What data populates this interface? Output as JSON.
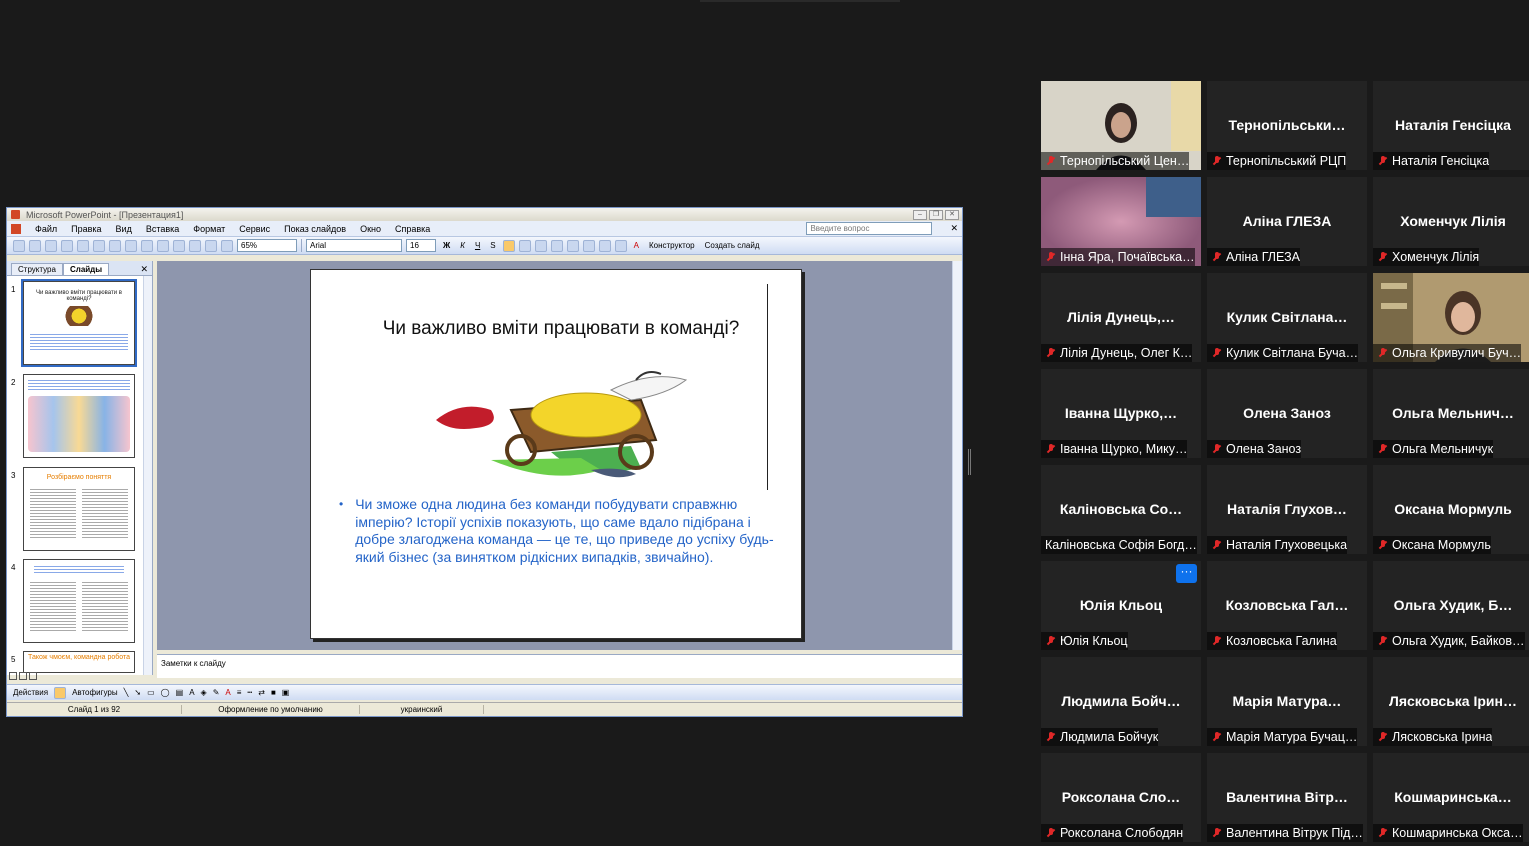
{
  "ppt": {
    "window_title": "Microsoft PowerPoint - [Презентация1]",
    "menu": [
      "Файл",
      "Правка",
      "Вид",
      "Вставка",
      "Формат",
      "Сервис",
      "Показ слайдов",
      "Окно",
      "Справка"
    ],
    "ask_placeholder": "Введите вопрос",
    "zoom": "65%",
    "font": "Arial",
    "font_size": "16",
    "designer_label": "Конструктор",
    "new_slide_label": "Создать слайд",
    "tabs": [
      "Структура",
      "Слайды"
    ],
    "thumbs": [
      {
        "num": "1"
      },
      {
        "num": "2"
      },
      {
        "num": "3",
        "title": "Розбіраємо поняття"
      },
      {
        "num": "4"
      },
      {
        "num": "5",
        "title": "Також чмоєм, командна робота"
      }
    ],
    "slide": {
      "title": "Чи важливо вміти працювати в команді?",
      "bullet": "Чи зможе одна людина без команди побудувати справжню імперію? Історії успіхів показують, що саме вдало підібрана і добре злагоджена команда — це те, що приведе до успіху будь-який бізнес (за винятком рідкісних випадків, звичайно)."
    },
    "notes_placeholder": "Заметки к слайду",
    "draw_actions": "Действия",
    "draw_autoshapes": "Автофигуры",
    "status": {
      "slide": "Слайд 1 из 92",
      "design": "Оформление по умолчанию",
      "lang": "украинский"
    }
  },
  "participants": [
    {
      "name": "",
      "label": "Тернопільський Цен…",
      "video": "woman-dark"
    },
    {
      "name": "Тернопільськи…",
      "label": "Тернопільський РЦП"
    },
    {
      "name": "Наталія Генсіцка",
      "label": "Наталія Генсіцка"
    },
    {
      "name": "",
      "label": "Інна Яра, Почаївська…",
      "video": "blur-pink"
    },
    {
      "name": "Аліна ГЛЕЗА",
      "label": "Аліна ГЛЕЗА"
    },
    {
      "name": "Хоменчук Лілія",
      "label": "Хоменчук Лілія"
    },
    {
      "name": "Лілія Дунець,…",
      "label": "Лілія Дунець, Олег К…"
    },
    {
      "name": "Кулик Світлана…",
      "label": "Кулик Світлана Буча…"
    },
    {
      "name": "",
      "label": "Ольга Кривулич Буч…",
      "video": "woman-shelf"
    },
    {
      "name": "Іванна Щурко,…",
      "label": "Іванна Щурко, Мику…"
    },
    {
      "name": "Олена Заноз",
      "label": "Олена Заноз"
    },
    {
      "name": "Ольга Мельнич…",
      "label": "Ольга Мельничук"
    },
    {
      "name": "Каліновська Со…",
      "label": "Каліновська Софія Богд…",
      "nomic": true
    },
    {
      "name": "Наталія Глухов…",
      "label": "Наталія Глуховецька"
    },
    {
      "name": "Оксана Мормуль",
      "label": "Оксана Мормуль"
    },
    {
      "name": "Юлія Кльоц",
      "label": "Юлія Кльоц",
      "more": "···"
    },
    {
      "name": "Козловська Гал…",
      "label": "Козловська Галина"
    },
    {
      "name": "Ольга Худик, Б…",
      "label": "Ольга Худик, Байков…"
    },
    {
      "name": "Людмила Бойч…",
      "label": "Людмила Бойчук"
    },
    {
      "name": "Марія Матура…",
      "label": "Марія Матура Бучац…"
    },
    {
      "name": "Лясковська Ірин…",
      "label": "Лясковська Ірина"
    },
    {
      "name": "Роксолана Сло…",
      "label": "Роксолана Слободян"
    },
    {
      "name": "Валентина Вітр…",
      "label": "Валентина Вітрук Під…"
    },
    {
      "name": "Кошмаринська…",
      "label": "Кошмаринська Окса…"
    }
  ]
}
